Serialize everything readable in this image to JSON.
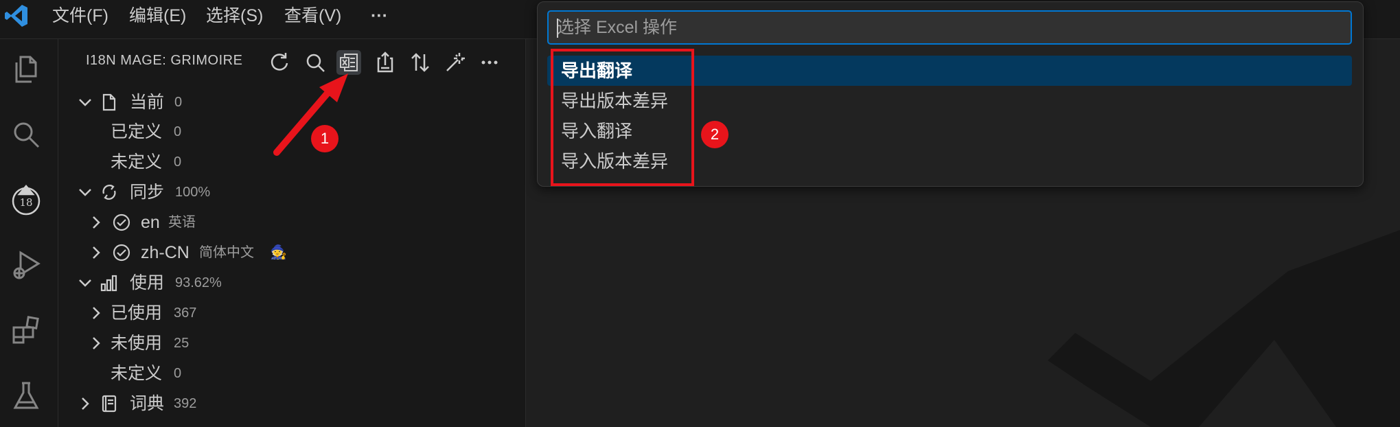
{
  "menubar": {
    "logo_icon": "vscode-logo-icon",
    "items": [
      "文件(F)",
      "编辑(E)",
      "选择(S)",
      "查看(V)"
    ],
    "more": "···"
  },
  "activity_bar": {
    "icons": [
      "files-icon",
      "search-icon",
      "i18n-mage-icon",
      "run-debug-icon",
      "extensions-icon",
      "testing-icon"
    ]
  },
  "sidebar": {
    "title": "I18N MAGE: GRIMOIRE",
    "actions": [
      "refresh-icon",
      "search-icon",
      "excel-icon",
      "export-icon",
      "sort-icon",
      "magic-wand-icon",
      "more-icon"
    ],
    "tree": [
      {
        "label": "当前",
        "desc": "0",
        "icon": "file-icon",
        "expanded": true
      },
      {
        "label": "已定义",
        "desc": "0"
      },
      {
        "label": "未定义",
        "desc": "0"
      },
      {
        "label": "同步",
        "desc": "100%",
        "icon": "sync-icon",
        "expanded": true
      },
      {
        "label": "en",
        "desc": "英语",
        "icon": "check-circle-icon",
        "expanded": false
      },
      {
        "label": "zh-CN",
        "desc": "简体中文",
        "icon": "check-circle-icon",
        "expanded": false,
        "extra": "🧙"
      },
      {
        "label": "使用",
        "desc": "93.62%",
        "icon": "chart-bars-icon",
        "expanded": true
      },
      {
        "label": "已使用",
        "desc": "367",
        "expanded": false
      },
      {
        "label": "未使用",
        "desc": "25",
        "expanded": false
      },
      {
        "label": "未定义",
        "desc": "0"
      },
      {
        "label": "词典",
        "desc": "392",
        "icon": "dictionary-icon",
        "expanded": false
      }
    ]
  },
  "quick_pick": {
    "placeholder": "选择 Excel 操作",
    "items": [
      "导出翻译",
      "导出版本差异",
      "导入翻译",
      "导入版本差异"
    ],
    "selected_index": 0
  },
  "annotations": {
    "badge1": "1",
    "badge2": "2",
    "color": "#e8141b"
  },
  "colors": {
    "accent": "#0078d4",
    "selection": "#04395e",
    "annotation_red": "#e8141b"
  }
}
